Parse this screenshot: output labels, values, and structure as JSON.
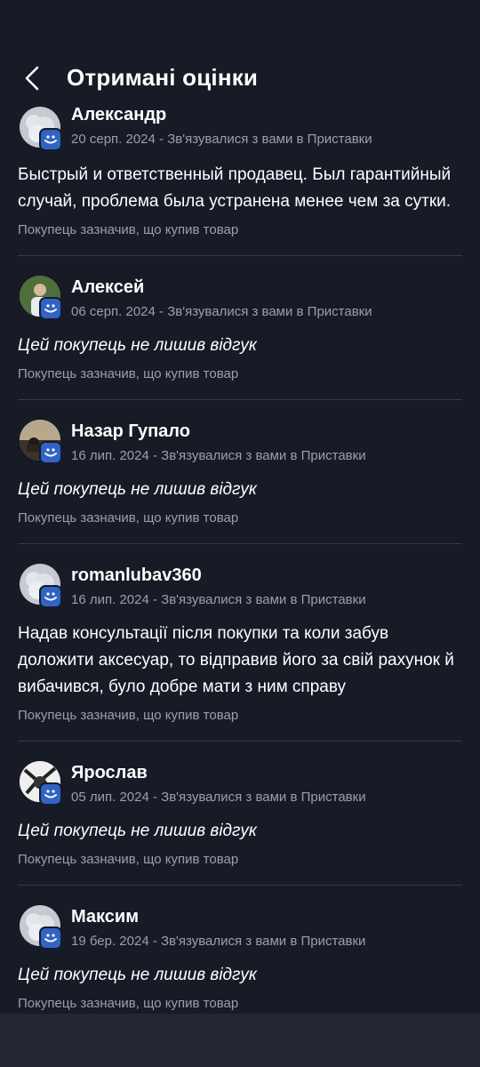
{
  "header": {
    "title": "Отримані оцінки"
  },
  "reviews": [
    {
      "name": "Александр",
      "meta": "20 серп. 2024 - Зв'язувалися з вами в Приставки",
      "text": "Быстрый и ответственный продавец. Был гарантийный случай, проблема была устранена менее чем за сутки.",
      "note": "Покупець зазначив, що купив товар",
      "avatar": "default-avatar"
    },
    {
      "name": "Алексей",
      "meta": "06 серп. 2024 - Зв'язувалися з вами в Приставки",
      "text": "Цей покупець не лишив відгук",
      "note": "Покупець зазначив, що купив товар",
      "avatar": "photo-avatar"
    },
    {
      "name": "Назар Гупало",
      "meta": "16 лип. 2024 - Зв'язувалися з вами в Приставки",
      "text": "Цей покупець не лишив відгук",
      "note": "Покупець зазначив, що купив товар",
      "avatar": "photo-avatar"
    },
    {
      "name": "romanlubav360",
      "meta": "16 лип. 2024 - Зв'язувалися з вами в Приставки",
      "text": "Надав консультації після покупки та коли забув доложити аксесуар, то відправив його за свій рахунок й вибачився, було добре мати з ним справу",
      "note": "Покупець зазначив, що купив товар",
      "avatar": "default-avatar"
    },
    {
      "name": "Ярослав",
      "meta": "05 лип. 2024 - Зв'язувалися з вами в Приставки",
      "text": "Цей покупець не лишив відгук",
      "note": "Покупець зазначив, що купив товар",
      "avatar": "photo-avatar"
    },
    {
      "name": "Максим",
      "meta": "19 бер. 2024 - Зв'язувалися з вами в Приставки",
      "text": "Цей покупець не лишив відгук",
      "note": "Покупець зазначив, що купив товар",
      "avatar": "default-avatar"
    }
  ]
}
